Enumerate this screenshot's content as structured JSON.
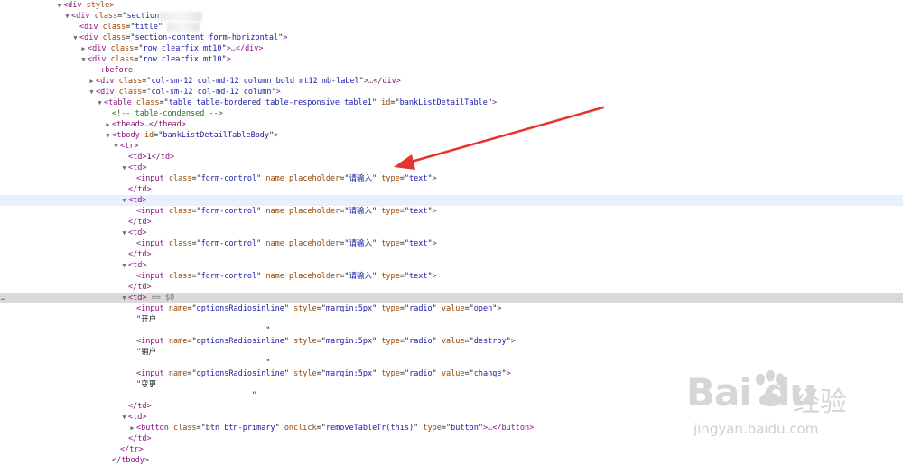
{
  "tree": [
    {
      "indent": 0,
      "tw": "▼",
      "html": "<span class=\"tag\">&lt;div</span> <span class=\"an\">style</span><span class=\"tag\">&gt;</span>"
    },
    {
      "indent": 1,
      "tw": "▼",
      "html": "<span class=\"tag\">&lt;div</span> <span class=\"an\">class</span>=\"<span class=\"av\">section</span><span class=\"blur\"></span>"
    },
    {
      "indent": 2,
      "tw": "",
      "html": "<span class=\"tag\">&lt;div</span> <span class=\"an\">class</span>=\"<span class=\"av\">title</span>\" <span class=\"blur\" style=\"width:36px\"></span>"
    },
    {
      "indent": 2,
      "tw": "▼",
      "html": "<span class=\"tag\">&lt;div</span> <span class=\"an\">class</span>=\"<span class=\"av\">section-content form-horizontal</span>\"<span class=\"tag\">&gt;</span>"
    },
    {
      "indent": 3,
      "tw": "▶",
      "html": "<span class=\"tag\">&lt;div</span> <span class=\"an\">class</span>=\"<span class=\"av\">row clearfix mt10</span>\"<span class=\"tag\">&gt;</span><span class=\"ellipsis\">…</span><span class=\"tag\">&lt;/div&gt;</span>"
    },
    {
      "indent": 3,
      "tw": "▼",
      "html": "<span class=\"tag\">&lt;div</span> <span class=\"an\">class</span>=\"<span class=\"av\">row clearfix mt10</span>\"<span class=\"tag\">&gt;</span>"
    },
    {
      "indent": 4,
      "tw": "",
      "html": "<span class=\"pseudo\">::before</span>"
    },
    {
      "indent": 4,
      "tw": "▶",
      "html": "<span class=\"tag\">&lt;div</span> <span class=\"an\">class</span>=\"<span class=\"av\">col-sm-12 col-md-12 column bold mt12 mb-label</span>\"<span class=\"tag\">&gt;</span><span class=\"ellipsis\">…</span><span class=\"tag\">&lt;/div&gt;</span>"
    },
    {
      "indent": 4,
      "tw": "▼",
      "html": "<span class=\"tag\">&lt;div</span> <span class=\"an\">class</span>=\"<span class=\"av\">col-sm-12 col-md-12 column</span>\"<span class=\"tag\">&gt;</span>"
    },
    {
      "indent": 5,
      "tw": "▼",
      "html": "<span class=\"tag\">&lt;table</span> <span class=\"an\">class</span>=\"<span class=\"av\">table table-bordered table-responsive table1</span>\" <span class=\"an\">id</span>=\"<span class=\"av\">bankListDetailTable</span>\"<span class=\"tag\">&gt;</span>"
    },
    {
      "indent": 6,
      "tw": "",
      "html": "<span class=\"comment\">&lt;!-- table-condensed --&gt;</span>"
    },
    {
      "indent": 6,
      "tw": "▶",
      "html": "<span class=\"tag\">&lt;thead&gt;</span><span class=\"ellipsis\">…</span><span class=\"tag\">&lt;/thead&gt;</span>"
    },
    {
      "indent": 6,
      "tw": "▼",
      "html": "<span class=\"tag\">&lt;tbody</span> <span class=\"an\">id</span>=\"<span class=\"av\">bankListDetailTableBody</span>\"<span class=\"tag\">&gt;</span>"
    },
    {
      "indent": 7,
      "tw": "▼",
      "html": "<span class=\"tag\">&lt;tr&gt;</span>"
    },
    {
      "indent": 8,
      "tw": "",
      "html": "<span class=\"tag\">&lt;td&gt;</span><span class=\"txt\">1</span><span class=\"tag\">&lt;/td&gt;</span>"
    },
    {
      "indent": 8,
      "tw": "▼",
      "html": "<span class=\"tag\">&lt;td&gt;</span>"
    },
    {
      "indent": 9,
      "tw": "",
      "html": "<span class=\"tag\">&lt;input</span> <span class=\"an\">class</span>=\"<span class=\"av\">form-control</span>\" <span class=\"an\">name</span> <span class=\"an\">placeholder</span>=\"<span class=\"av\">请输入</span>\" <span class=\"an\">type</span>=\"<span class=\"av\">text</span>\"<span class=\"tag\">&gt;</span>"
    },
    {
      "indent": 8,
      "tw": "",
      "html": "<span class=\"tag\">&lt;/td&gt;</span>"
    },
    {
      "indent": 8,
      "tw": "▼",
      "html": "<span class=\"tag\">&lt;td&gt;</span>",
      "cls": "hover"
    },
    {
      "indent": 9,
      "tw": "",
      "html": "<span class=\"tag\">&lt;input</span> <span class=\"an\">class</span>=\"<span class=\"av\">form-control</span>\" <span class=\"an\">name</span> <span class=\"an\">placeholder</span>=\"<span class=\"av\">请输入</span>\" <span class=\"an\">type</span>=\"<span class=\"av\">text</span>\"<span class=\"tag\">&gt;</span>"
    },
    {
      "indent": 8,
      "tw": "",
      "html": "<span class=\"tag\">&lt;/td&gt;</span>"
    },
    {
      "indent": 8,
      "tw": "▼",
      "html": "<span class=\"tag\">&lt;td&gt;</span>"
    },
    {
      "indent": 9,
      "tw": "",
      "html": "<span class=\"tag\">&lt;input</span> <span class=\"an\">class</span>=\"<span class=\"av\">form-control</span>\" <span class=\"an\">name</span> <span class=\"an\">placeholder</span>=\"<span class=\"av\">请输入</span>\" <span class=\"an\">type</span>=\"<span class=\"av\">text</span>\"<span class=\"tag\">&gt;</span>"
    },
    {
      "indent": 8,
      "tw": "",
      "html": "<span class=\"tag\">&lt;/td&gt;</span>"
    },
    {
      "indent": 8,
      "tw": "▼",
      "html": "<span class=\"tag\">&lt;td&gt;</span>"
    },
    {
      "indent": 9,
      "tw": "",
      "html": "<span class=\"tag\">&lt;input</span> <span class=\"an\">class</span>=\"<span class=\"av\">form-control</span>\" <span class=\"an\">name</span> <span class=\"an\">placeholder</span>=\"<span class=\"av\">请输入</span>\" <span class=\"an\">type</span>=\"<span class=\"av\">text</span>\"<span class=\"tag\">&gt;</span>"
    },
    {
      "indent": 8,
      "tw": "",
      "html": "<span class=\"tag\">&lt;/td&gt;</span>"
    },
    {
      "indent": 8,
      "tw": "▼",
      "html": "<span class=\"tag\">&lt;td&gt;</span> <span class=\"sel-eq\">== $0</span>",
      "cls": "selected",
      "gutter": "…"
    },
    {
      "indent": 9,
      "tw": "",
      "html": "<span class=\"tag\">&lt;input</span> <span class=\"an\">name</span>=\"<span class=\"av\">optionsRadiosinline</span>\" <span class=\"an\">style</span>=\"<span class=\"av\">margin:5px</span>\" <span class=\"an\">type</span>=\"<span class=\"av\">radio</span>\" <span class=\"an\">value</span>=\"<span class=\"av\">open</span>\"<span class=\"tag\">&gt;</span>"
    },
    {
      "indent": 9,
      "tw": "",
      "html": "<span class=\"txt\">\"开户</span>"
    },
    {
      "indent": 9,
      "tw": "",
      "html": "<span class=\"txt\">                            \"</span>"
    },
    {
      "indent": 9,
      "tw": "",
      "html": "<span class=\"tag\">&lt;input</span> <span class=\"an\">name</span>=\"<span class=\"av\">optionsRadiosinline</span>\" <span class=\"an\">style</span>=\"<span class=\"av\">margin:5px</span>\" <span class=\"an\">type</span>=\"<span class=\"av\">radio</span>\" <span class=\"an\">value</span>=\"<span class=\"av\">destroy</span>\"<span class=\"tag\">&gt;</span>"
    },
    {
      "indent": 9,
      "tw": "",
      "html": "<span class=\"txt\">\"销户</span>"
    },
    {
      "indent": 9,
      "tw": "",
      "html": "<span class=\"txt\">                            \"</span>"
    },
    {
      "indent": 9,
      "tw": "",
      "html": "<span class=\"tag\">&lt;input</span> <span class=\"an\">name</span>=\"<span class=\"av\">optionsRadiosinline</span>\" <span class=\"an\">style</span>=\"<span class=\"av\">margin:5px</span>\" <span class=\"an\">type</span>=\"<span class=\"av\">radio</span>\" <span class=\"an\">value</span>=\"<span class=\"av\">change</span>\"<span class=\"tag\">&gt;</span>"
    },
    {
      "indent": 9,
      "tw": "",
      "html": "<span class=\"txt\">\"变更</span>"
    },
    {
      "indent": 9,
      "tw": "",
      "html": "<span class=\"txt\">                         \"</span>"
    },
    {
      "indent": 8,
      "tw": "",
      "html": "<span class=\"tag\">&lt;/td&gt;</span>"
    },
    {
      "indent": 8,
      "tw": "▼",
      "html": "<span class=\"tag\">&lt;td&gt;</span>"
    },
    {
      "indent": 9,
      "tw": "▶",
      "html": "<span class=\"tag\">&lt;button</span> <span class=\"an\">class</span>=\"<span class=\"av\">btn btn-primary</span>\" <span class=\"an\">onclick</span>=\"<span class=\"av\">removeTableTr(this)</span>\" <span class=\"an\">type</span>=\"<span class=\"av\">button</span>\"<span class=\"tag\">&gt;</span><span class=\"ellipsis\">…</span><span class=\"tag\">&lt;/button&gt;</span>"
    },
    {
      "indent": 8,
      "tw": "",
      "html": "<span class=\"tag\">&lt;/td&gt;</span>"
    },
    {
      "indent": 7,
      "tw": "",
      "html": "<span class=\"tag\">&lt;/tr&gt;</span>"
    },
    {
      "indent": 6,
      "tw": "",
      "html": "<span class=\"tag\">&lt;/tbody&gt;</span>"
    }
  ],
  "watermark": {
    "brand": "Bai du",
    "brand_cn": "经验",
    "url": "jingyan.baidu.com"
  },
  "colors": {
    "arrow": "#e8322b",
    "tag": "#881280",
    "attr_name": "#994500",
    "attr_value": "#1a1aa6",
    "comment": "#236e25"
  }
}
